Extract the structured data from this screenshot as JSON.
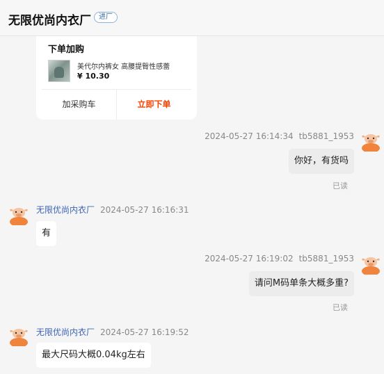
{
  "header": {
    "title": "无限优尚内衣厂",
    "badge": "进厂"
  },
  "product_card": {
    "title": "下单加购",
    "product_name": "美代尔内裤女 高腰提臀性感蕾",
    "price": "¥ 10.30",
    "add_cart_label": "加采购车",
    "order_now_label": "立即下单",
    "accent_color": "#ff4000"
  },
  "messages": [
    {
      "direction": "out",
      "time": "2024-05-27 16:14:34",
      "sender": "tb5881_1953",
      "text": "你好，有货吗",
      "status": "已读"
    },
    {
      "direction": "in",
      "sender": "无限优尚内衣厂",
      "time": "2024-05-27 16:16:31",
      "text": "有"
    },
    {
      "direction": "out",
      "time": "2024-05-27 16:19:02",
      "sender": "tb5881_1953",
      "text": "请问M码单条大概多重?",
      "status": "已读"
    },
    {
      "direction": "in",
      "sender": "无限优尚内衣厂",
      "time": "2024-05-27 16:19:52",
      "text": "最大尺码大概0.04kg左右"
    }
  ],
  "icons": {
    "avatar": "cartoon-cow-avatar-icon"
  },
  "colors": {
    "shop_name": "#3d63b8",
    "avatar": "#f0843c"
  }
}
